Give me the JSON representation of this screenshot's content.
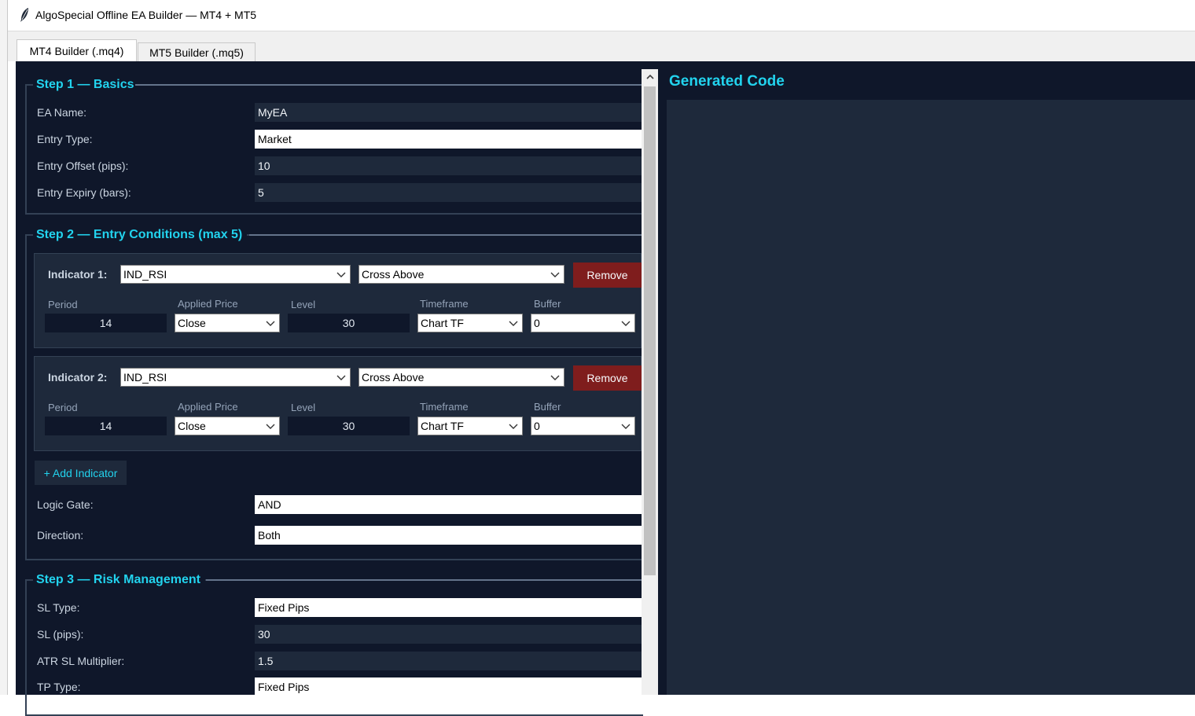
{
  "window": {
    "title": "AlgoSpecial Offline EA Builder — MT4 + MT5",
    "icon": "feather-icon"
  },
  "tabs": [
    {
      "label": "MT4 Builder (.mq4)",
      "active": true
    },
    {
      "label": "MT5 Builder (.mq5)",
      "active": false
    }
  ],
  "step1": {
    "title": "Step 1 — Basics",
    "fields": [
      {
        "label": "EA Name:",
        "value": "MyEA"
      },
      {
        "label": "Entry Type:",
        "value": "Market"
      },
      {
        "label": "Entry Offset (pips):",
        "value": "10"
      },
      {
        "label": "Entry Expiry (bars):",
        "value": "5"
      }
    ]
  },
  "step2": {
    "title": "Step 2 — Entry Conditions (max 5)",
    "sub_labels": {
      "period": "Period",
      "applied_price": "Applied Price",
      "level": "Level",
      "timeframe": "Timeframe",
      "buffer": "Buffer"
    },
    "indicators": [
      {
        "label": "Indicator 1:",
        "indicator": "IND_RSI",
        "condition": "Cross Above",
        "remove": "Remove",
        "period": "14",
        "applied_price": "Close",
        "level": "30",
        "timeframe": "Chart TF",
        "buffer": "0"
      },
      {
        "label": "Indicator 2:",
        "indicator": "IND_RSI",
        "condition": "Cross Above",
        "remove": "Remove",
        "period": "14",
        "applied_price": "Close",
        "level": "30",
        "timeframe": "Chart TF",
        "buffer": "0"
      }
    ],
    "add_indicator": "+ Add Indicator",
    "logic_gate": {
      "label": "Logic Gate:",
      "value": "AND"
    },
    "direction": {
      "label": "Direction:",
      "value": "Both"
    }
  },
  "step3": {
    "title": "Step 3 — Risk Management",
    "fields": [
      {
        "label": "SL Type:",
        "value": "Fixed Pips"
      },
      {
        "label": "SL (pips):",
        "value": "30"
      },
      {
        "label": "ATR SL Multiplier:",
        "value": "1.5"
      },
      {
        "label": "TP Type:",
        "value": "Fixed Pips"
      }
    ]
  },
  "code_panel": {
    "title": "Generated Code",
    "content": ""
  },
  "colors": {
    "background": "#0f172a",
    "panel": "#1e293b",
    "accent": "#22d3ee",
    "danger": "#7f1d1d"
  }
}
